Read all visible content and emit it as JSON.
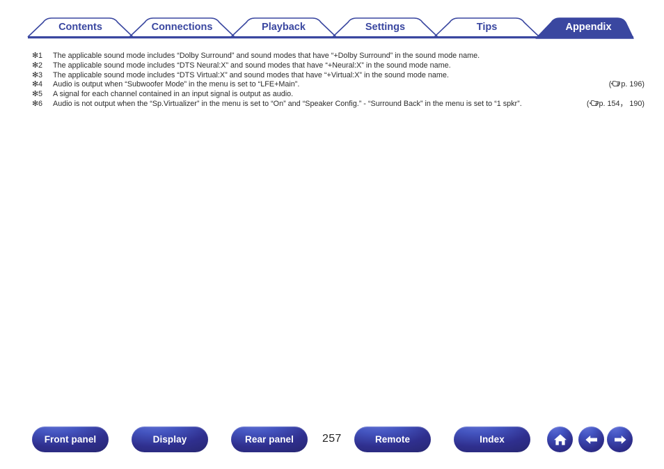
{
  "tabs": [
    {
      "label": "Contents",
      "active": false
    },
    {
      "label": "Connections",
      "active": false
    },
    {
      "label": "Playback",
      "active": false
    },
    {
      "label": "Settings",
      "active": false
    },
    {
      "label": "Tips",
      "active": false
    },
    {
      "label": "Appendix",
      "active": true
    }
  ],
  "notes": [
    {
      "marker": "✻1",
      "text": "The applicable sound mode includes “Dolby Surround” and sound modes that have “+Dolby Surround” in the sound mode name.",
      "pageref": ""
    },
    {
      "marker": "✻2",
      "text": "The applicable sound mode includes “DTS Neural:X” and sound modes that have “+Neural:X” in the sound mode name.",
      "pageref": ""
    },
    {
      "marker": "✻3",
      "text": "The applicable sound mode includes “DTS Virtual:X” and sound modes that have “+Virtual:X” in the sound mode name.",
      "pageref": ""
    },
    {
      "marker": "✻4",
      "text": "Audio is output when “Subwoofer Mode” in the menu is set to “LFE+Main”.",
      "pageref": "p. 196"
    },
    {
      "marker": "✻5",
      "text": "A signal for each channel contained in an input signal is output as audio.",
      "pageref": ""
    },
    {
      "marker": "✻6",
      "text": "Audio is not output when the “Sp.Virtualizer” in the menu is set to “On” and “Speaker Config.” - “Surround Back” in the menu is set to “1 spkr”.",
      "pageref": "p. 154， 190"
    }
  ],
  "footer": {
    "buttons": [
      {
        "label": "Front panel"
      },
      {
        "label": "Display"
      },
      {
        "label": "Rear panel"
      },
      {
        "label": "Remote"
      },
      {
        "label": "Index"
      }
    ],
    "page_number": "257",
    "icons": [
      {
        "name": "home-icon"
      },
      {
        "name": "back-arrow-icon"
      },
      {
        "name": "forward-arrow-icon"
      }
    ]
  },
  "colors": {
    "tab_text": "#3a47a0",
    "tab_active_bg": "#3a47a0",
    "rule": "#3a47a0",
    "body_text": "#2b2b2b",
    "button_gradient_top": "#5566cc",
    "button_gradient_bottom": "#272770"
  }
}
